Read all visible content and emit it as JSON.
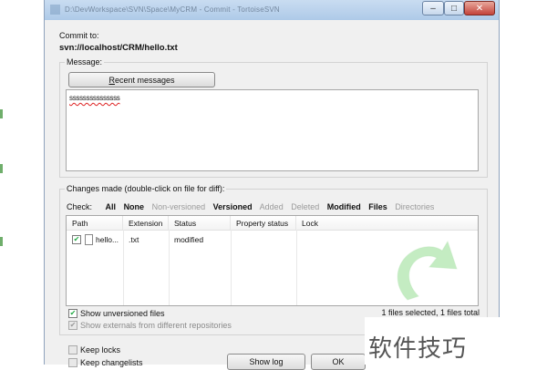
{
  "window": {
    "title": "D:\\DevWorkspace\\SVN\\Space\\MyCRM - Commit - TortoiseSVN",
    "minimize_glyph": "–",
    "maximize_glyph": "□",
    "close_glyph": "✕"
  },
  "commit": {
    "label": "Commit to:",
    "url": "svn://localhost/CRM/hello.txt"
  },
  "message": {
    "group_label": "Message:",
    "recent_button": "Recent messages",
    "recent_button_mnemonic": "R",
    "text": "sssssssssssssss"
  },
  "changes": {
    "group_label": "Changes made (double-click on file for diff):",
    "check_label": "Check:",
    "filters": [
      {
        "label": "All",
        "enabled": true
      },
      {
        "label": "None",
        "enabled": true
      },
      {
        "label": "Non-versioned",
        "enabled": false
      },
      {
        "label": "Versioned",
        "enabled": true
      },
      {
        "label": "Added",
        "enabled": false
      },
      {
        "label": "Deleted",
        "enabled": false
      },
      {
        "label": "Modified",
        "enabled": true
      },
      {
        "label": "Files",
        "enabled": true
      },
      {
        "label": "Directories",
        "enabled": false
      }
    ],
    "columns": [
      "Path",
      "Extension",
      "Status",
      "Property status",
      "Lock"
    ],
    "rows": [
      {
        "checked": true,
        "path": "hello...",
        "extension": ".txt",
        "status": "modified",
        "property_status": "",
        "lock": ""
      }
    ],
    "show_unversioned_label": "Show unversioned files",
    "show_unversioned_checked": true,
    "show_externals_label": "Show externals from different repositories",
    "show_externals_checked": true,
    "selection_status": "1 files selected, 1 files total"
  },
  "options": {
    "keep_locks": "Keep locks",
    "keep_changelists": "Keep changelists"
  },
  "buttons": {
    "show_log": "Show log",
    "ok": "OK"
  },
  "watermark": {
    "text": "软件技巧"
  },
  "colors": {
    "titlebar": "#aecae8",
    "dialog_bg": "#f0f0f0",
    "arrow_green": "#7ed67a",
    "close_red": "#c4433a"
  }
}
